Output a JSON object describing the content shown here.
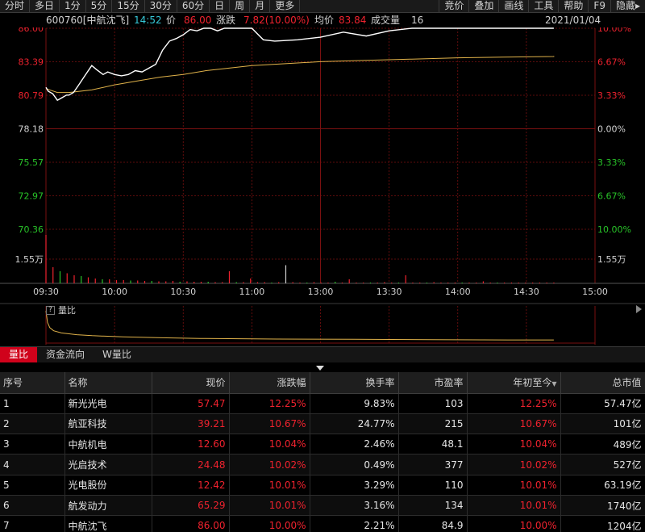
{
  "toolbar": {
    "left": [
      "分时",
      "多日",
      "1分",
      "5分",
      "15分",
      "30分",
      "60分",
      "日",
      "周",
      "月",
      "更多"
    ],
    "right": [
      "竞价",
      "叠加",
      "画线",
      "工具",
      "帮助",
      "F9",
      "隐藏▸"
    ]
  },
  "info": {
    "code": "600760[中航沈飞]",
    "time": "14:52",
    "price_label": "价",
    "price": "86.00",
    "change_label": "涨跌",
    "change": "7.82(10.00%)",
    "avg_label": "均价",
    "avg": "83.84",
    "volume_label": "成交量",
    "volume": "16",
    "date": "2021/01/04"
  },
  "colors": {
    "up": "#f0222e",
    "down": "#28c328",
    "neutral": "#d2d2d2",
    "price_line": "#ffffff",
    "avg_line": "#e0b24a",
    "time_cyan": "#36c8d8",
    "grid": "#7a1010",
    "tab_active": "#d0021b"
  },
  "chart_data": {
    "type": "line",
    "title": "",
    "x_ticks": [
      "09:30",
      "10:00",
      "10:30",
      "11:00",
      "13:00",
      "13:30",
      "14:00",
      "14:30",
      "15:00"
    ],
    "left_axis": [
      "86.00",
      "83.39",
      "80.79",
      "78.18",
      "75.57",
      "72.97",
      "70.36"
    ],
    "right_axis": [
      "10.00%",
      "6.67%",
      "3.33%",
      "0.00%",
      "3.33%",
      "6.67%",
      "10.00%"
    ],
    "volume_axis_label": "1.55万",
    "ylim": [
      70.36,
      86.0
    ],
    "prev_close": 78.18,
    "price_series": {
      "x": [
        0,
        1,
        3,
        5,
        7,
        9,
        10,
        12,
        14,
        17,
        20,
        22,
        25,
        27,
        30,
        33,
        36,
        39,
        42,
        45,
        48,
        51,
        54,
        57,
        60,
        63,
        66,
        69,
        72,
        75,
        78,
        80,
        82,
        84,
        87,
        90,
        95,
        100,
        110,
        120,
        130,
        140,
        150,
        160,
        170,
        180,
        190,
        200,
        212,
        222
      ],
      "values": [
        81.4,
        81.1,
        80.9,
        80.4,
        80.6,
        80.8,
        80.8,
        81.0,
        81.5,
        82.3,
        83.1,
        82.8,
        82.4,
        82.6,
        82.4,
        82.3,
        82.4,
        82.7,
        82.6,
        82.9,
        83.2,
        84.3,
        85.0,
        85.2,
        85.5,
        85.9,
        85.8,
        86.0,
        86.0,
        85.8,
        86.0,
        86.0,
        86.0,
        86.0,
        86.0,
        86.0,
        85.1,
        85.0,
        85.1,
        85.3,
        85.7,
        85.4,
        85.8,
        86.0,
        86.0,
        86.0,
        86.0,
        86.0,
        86.0,
        86.0
      ]
    },
    "avg_series": {
      "x": [
        0,
        5,
        10,
        20,
        30,
        40,
        50,
        60,
        70,
        80,
        90,
        100,
        120,
        140,
        160,
        180,
        200,
        240,
        300,
        360,
        420,
        500,
        600,
        660
      ],
      "values": [
        81.3,
        81.0,
        81.0,
        81.2,
        81.6,
        81.9,
        82.2,
        82.4,
        82.7,
        82.9,
        83.1,
        83.2,
        83.4,
        83.5,
        83.6,
        83.7,
        83.75,
        83.8,
        83.82,
        83.83,
        83.84,
        83.84,
        83.84,
        83.84
      ]
    },
    "volume_series": {
      "values": [
        1.2,
        0.4,
        0.3,
        0.25,
        0.2,
        0.18,
        0.15,
        0.12,
        0.1,
        0.1,
        0.08,
        0.08,
        0.07,
        0.07,
        0.06,
        0.06,
        0.05,
        0.05,
        0.06,
        0.04,
        0.05,
        0.04,
        0.04,
        0.04,
        0.03,
        0.03,
        0.3,
        0.03,
        0.03,
        0.12,
        0.03,
        0.03,
        0.02,
        0.03,
        0.45,
        0.03,
        0.02,
        0.02,
        0.03,
        0.02,
        0.02,
        0.04,
        0.02,
        0.1,
        0.02,
        0.02,
        0.02,
        0.02,
        0.03,
        0.02,
        0.02,
        0.2,
        0.02,
        0.02,
        0.02,
        0.03,
        0.02,
        0.02,
        0.02,
        0.02,
        0.02,
        0.02,
        0.05,
        0.02,
        0.02,
        0.02,
        0.02,
        0.02,
        0.02,
        0.02,
        0.02,
        0.02,
        0.02
      ],
      "colors": [
        "up",
        "up",
        "down",
        "up",
        "up",
        "down",
        "up",
        "up",
        "down",
        "up",
        "up",
        "up",
        "down",
        "up",
        "up",
        "down",
        "up",
        "up",
        "up",
        "down",
        "up",
        "up",
        "up",
        "down",
        "up",
        "up",
        "up",
        "down",
        "up",
        "up",
        "up",
        "up",
        "down",
        "up",
        "neutral",
        "up",
        "up",
        "down",
        "up",
        "up",
        "up",
        "down",
        "up",
        "up",
        "up",
        "up",
        "down",
        "up",
        "up",
        "up",
        "down",
        "up",
        "up",
        "up",
        "down",
        "up",
        "up",
        "up",
        "up",
        "down",
        "up",
        "up",
        "up",
        "up",
        "down",
        "up",
        "up",
        "up",
        "up",
        "up",
        "up",
        "up",
        "up"
      ]
    },
    "volume_ratio_label": "量比",
    "volume_ratio_series": {
      "x": [
        0,
        2,
        5,
        10,
        20,
        40,
        60,
        100,
        150,
        200,
        300,
        400,
        500,
        600,
        660
      ],
      "values": [
        1.0,
        0.62,
        0.45,
        0.35,
        0.28,
        0.22,
        0.19,
        0.15,
        0.12,
        0.1,
        0.08,
        0.07,
        0.06,
        0.05,
        0.05
      ]
    }
  },
  "tabs": [
    "量比",
    "资金流向",
    "W量比"
  ],
  "table": {
    "columns": [
      "序号",
      "名称",
      "现价",
      "涨跌幅",
      "换手率",
      "市盈率",
      "年初至今",
      "总市值"
    ],
    "sort_indicator": "▼",
    "rows": [
      [
        "1",
        "新光光电",
        "57.47",
        "12.25%",
        "9.83%",
        "103",
        "12.25%",
        "57.47亿"
      ],
      [
        "2",
        "航亚科技",
        "39.21",
        "10.67%",
        "24.77%",
        "215",
        "10.67%",
        "101亿"
      ],
      [
        "3",
        "中航机电",
        "12.60",
        "10.04%",
        "2.46%",
        "48.1",
        "10.04%",
        "489亿"
      ],
      [
        "4",
        "光启技术",
        "24.48",
        "10.02%",
        "0.49%",
        "377",
        "10.02%",
        "527亿"
      ],
      [
        "5",
        "光电股份",
        "12.42",
        "10.01%",
        "3.29%",
        "110",
        "10.01%",
        "63.19亿"
      ],
      [
        "6",
        "航发动力",
        "65.29",
        "10.01%",
        "3.16%",
        "134",
        "10.01%",
        "1740亿"
      ],
      [
        "7",
        "中航沈飞",
        "86.00",
        "10.00%",
        "2.21%",
        "84.9",
        "10.00%",
        "1204亿"
      ]
    ]
  }
}
